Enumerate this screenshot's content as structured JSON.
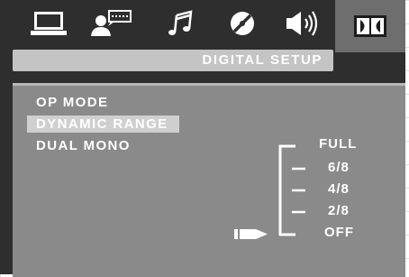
{
  "tabs": [
    {
      "icon": "monitor-icon",
      "active": false
    },
    {
      "icon": "speaker-subtitle-icon",
      "active": false
    },
    {
      "icon": "music-note-icon",
      "active": false
    },
    {
      "icon": "disc-icon",
      "active": false
    },
    {
      "icon": "speaker-volume-icon",
      "active": false
    },
    {
      "icon": "dolby-digital-icon",
      "active": true
    }
  ],
  "header": {
    "title": "DIGITAL SETUP"
  },
  "menu": {
    "items": [
      {
        "label": "OP MODE"
      },
      {
        "label": "DYNAMIC RANGE",
        "selected": true
      },
      {
        "label": "DUAL MONO"
      }
    ]
  },
  "dynamic_range": {
    "levels": [
      "FULL",
      "6/8",
      "4/8",
      "2/8",
      "OFF"
    ],
    "current": "OFF"
  },
  "colors": {
    "background": "#2e2e2e",
    "panel": "#8a8a8a",
    "highlight": "#cfcfcf",
    "title_bar": "#c4c4c4",
    "text": "#ffffff"
  }
}
